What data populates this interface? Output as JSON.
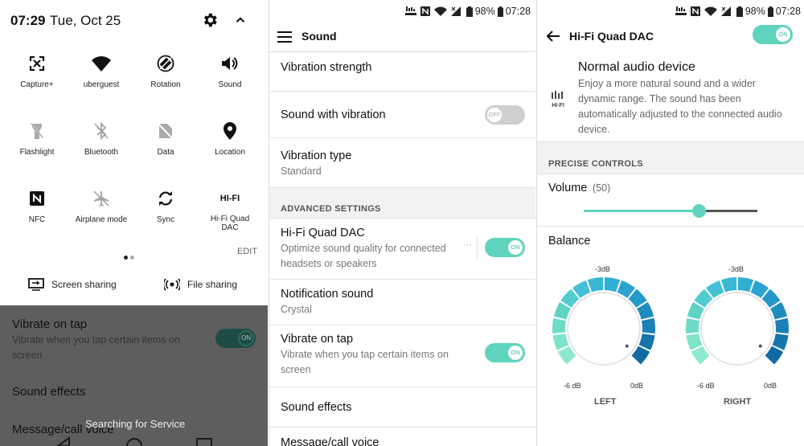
{
  "quick_settings": {
    "time": "07:29",
    "date": "Tue, Oct 25",
    "tiles": [
      {
        "label": "Capture+",
        "icon": "capture-plus-icon"
      },
      {
        "label": "uberguest",
        "icon": "wifi-icon"
      },
      {
        "label": "Rotation",
        "icon": "rotation-icon"
      },
      {
        "label": "Sound",
        "icon": "sound-icon"
      },
      {
        "label": "Flashlight",
        "icon": "flashlight-icon"
      },
      {
        "label": "Bluetooth",
        "icon": "bluetooth-icon"
      },
      {
        "label": "Data",
        "icon": "data-icon"
      },
      {
        "label": "Location",
        "icon": "location-icon"
      },
      {
        "label": "NFC",
        "icon": "nfc-icon"
      },
      {
        "label": "Airplane mode",
        "icon": "airplane-icon"
      },
      {
        "label": "Sync",
        "icon": "sync-icon"
      },
      {
        "label": "Hi-Fi Quad DAC",
        "icon": "hifi-icon",
        "icon_text": "HI-FI"
      }
    ],
    "edit": "EDIT",
    "screen_sharing": "Screen sharing",
    "file_sharing": "File sharing",
    "behind": {
      "vibrate_title": "Vibrate on tap",
      "vibrate_sub": "Vibrate when you tap certain items on screen",
      "toggle": "ON",
      "sound_effects": "Sound effects",
      "message_voice": "Message/call voice",
      "searching": "Searching for Service"
    }
  },
  "status_bar": {
    "battery": "98%",
    "time": "07:28"
  },
  "sound": {
    "title": "Sound",
    "vibration_strength": "Vibration strength",
    "sound_with_vibration": "Sound with vibration",
    "sound_with_vibration_toggle": "OFF",
    "vibration_type": "Vibration type",
    "vibration_type_value": "Standard",
    "advanced_header": "ADVANCED SETTINGS",
    "hifi_title": "Hi-Fi Quad DAC",
    "hifi_sub": "Optimize sound quality for connected headsets or speakers",
    "hifi_toggle": "ON",
    "hifi_more": "···",
    "notification_sound": "Notification sound",
    "notification_value": "Crystal",
    "vibrate_on_tap": "Vibrate on tap",
    "vibrate_on_tap_sub": "Vibrate when you tap certain items on screen",
    "vibrate_toggle": "ON",
    "sound_effects": "Sound effects",
    "message_voice": "Message/call voice"
  },
  "dac": {
    "title": "Hi-Fi Quad DAC",
    "toggle": "ON",
    "icon_text": "HI-FI",
    "device_title": "Normal audio device",
    "device_sub": "Enjoy a more natural sound and a wider dynamic range. The sound has been automatically adjusted to the connected audio device.",
    "precise_header": "PRECISE CONTROLS",
    "volume_label": "Volume",
    "volume_value": "(50)",
    "volume_level": 0.66,
    "balance_label": "Balance",
    "left": {
      "name": "LEFT",
      "top": "-3dB",
      "min": "-6 dB",
      "max": "0dB"
    },
    "right": {
      "name": "RIGHT",
      "top": "-3dB",
      "min": "-6 dB",
      "max": "0dB"
    },
    "accent": "#5fd3bd"
  }
}
